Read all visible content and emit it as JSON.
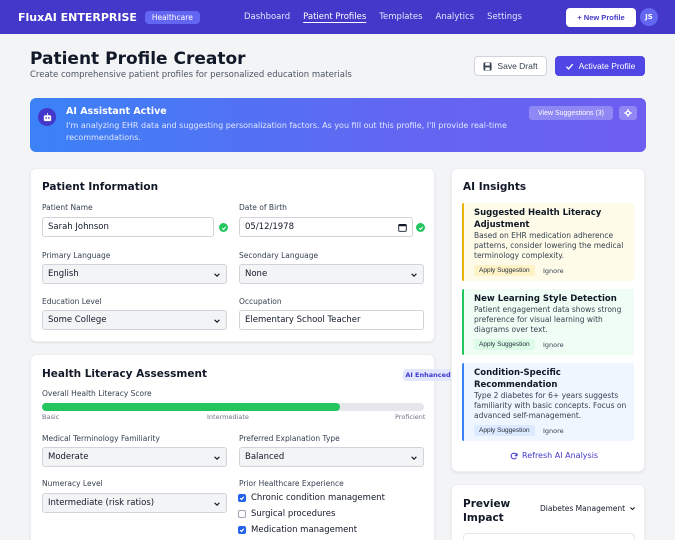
{
  "nav": {
    "brand": "FluxAI ENTERPRISE",
    "badge": "Healthcare",
    "links": [
      "Dashboard",
      "Patient Profiles",
      "Templates",
      "Analytics",
      "Settings"
    ],
    "new_button": "+ New Profile",
    "avatar": "JS"
  },
  "header": {
    "title": "Patient Profile Creator",
    "subtitle": "Create comprehensive patient profiles for personalized education materials",
    "save_label": "Save Draft",
    "activate_label": "Activate Profile"
  },
  "ai_banner": {
    "title": "AI Assistant Active",
    "text": "I'm analyzing EHR data and suggesting personalization factors. As you fill out this profile, I'll provide real-time recommendations.",
    "view_suggestions": "View Suggestions (3)"
  },
  "patient_info": {
    "title": "Patient Information",
    "name_label": "Patient Name",
    "name_value": "Sarah Johnson",
    "dob_label": "Date of Birth",
    "dob_value": "05/12/1978",
    "primary_lang_label": "Primary Language",
    "primary_lang_value": "English",
    "secondary_lang_label": "Secondary Language",
    "secondary_lang_value": "None",
    "education_label": "Education Level",
    "education_value": "Some College",
    "occupation_label": "Occupation",
    "occupation_value": "Elementary School Teacher"
  },
  "health_literacy": {
    "title": "Health Literacy Assessment",
    "badge": "AI Enhanced",
    "score_label": "Overall Health Literacy Score",
    "score_fraction": 0.78,
    "ticks": [
      "Basic",
      "Intermediate",
      "Proficient"
    ],
    "terminology_label": "Medical Terminology Familiarity",
    "terminology_value": "Moderate",
    "explanation_label": "Preferred Explanation Type",
    "explanation_value": "Balanced",
    "numeracy_label": "Numeracy Level",
    "numeracy_value": "Intermediate (risk ratios)",
    "experience_label": "Prior Healthcare Experience",
    "experience_items": [
      {
        "label": "Chronic condition management",
        "checked": true
      },
      {
        "label": "Surgical procedures",
        "checked": false
      },
      {
        "label": "Medication management",
        "checked": true
      }
    ]
  },
  "insights": {
    "title": "AI Insights",
    "items": [
      {
        "title": "Suggested Health Literacy Adjustment",
        "text": "Based on EHR medication adherence patterns, consider lowering the medical terminology complexity.",
        "apply": "Apply Suggestion",
        "ignore": "Ignore",
        "accent": "#eab308",
        "bg": "#fefce8",
        "btn_bg": "#fef3c7",
        "btn_color": "#1f2937"
      },
      {
        "title": "New Learning Style Detection",
        "text": "Patient engagement data shows strong preference for visual learning with diagrams over text.",
        "apply": "Apply Suggestion",
        "ignore": "Ignore",
        "accent": "#22c55e",
        "bg": "#f0fdf4",
        "btn_bg": "#dcfce7",
        "btn_color": "#1f2937"
      },
      {
        "title": "Condition-Specific Recommendation",
        "text": "Type 2 diabetes for 6+ years suggests familiarity with basic concepts. Focus on advanced self-management.",
        "apply": "Apply Suggestion",
        "ignore": "Ignore",
        "accent": "#3b82f6",
        "bg": "#eff6ff",
        "btn_bg": "#dbeafe",
        "btn_color": "#1f2937"
      }
    ],
    "refresh": "Refresh AI Analysis"
  },
  "preview": {
    "title": "Preview Impact",
    "select_value": "Diabetes Management"
  }
}
